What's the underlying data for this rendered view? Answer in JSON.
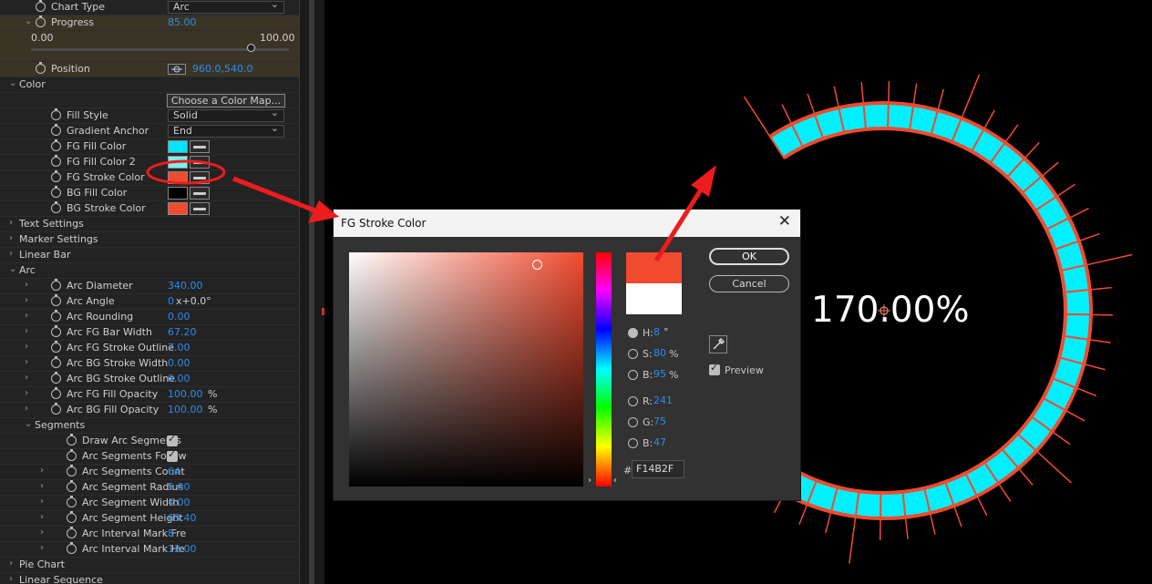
{
  "panel": {
    "rows": [
      {
        "type": "dropdown",
        "label": "Chart Type",
        "value": "Arc",
        "indent": 1,
        "arrow": "",
        "stop": true
      },
      {
        "type": "value",
        "label": "Progress",
        "value": "85.00",
        "indent": 1,
        "arrow": "⌄",
        "stop": true,
        "highlight": true
      },
      {
        "type": "slider",
        "min": "0.00",
        "max": "100.00",
        "fraction": 0.85,
        "highlight": true
      },
      {
        "type": "position",
        "label": "Position",
        "value": "960.0,540.0",
        "indent": 1,
        "arrow": "",
        "stop": true,
        "highlight": true
      },
      {
        "type": "group",
        "label": "Color",
        "indent": 0,
        "arrow": "⌄"
      },
      {
        "type": "button",
        "label": "Choose a Color Map..."
      },
      {
        "type": "dropdown",
        "label": "Fill Style",
        "value": "Solid",
        "indent": 2,
        "arrow": "",
        "stop": true
      },
      {
        "type": "dropdown",
        "label": "Gradient Anchor",
        "value": "End",
        "indent": 2,
        "arrow": "",
        "stop": true
      },
      {
        "type": "color",
        "label": "FG Fill Color",
        "color": "#00e5ff",
        "indent": 2,
        "stop": true
      },
      {
        "type": "color",
        "label": "FG Fill Color 2",
        "color": "#7af2ee",
        "indent": 2,
        "stop": true
      },
      {
        "type": "color",
        "label": "FG Stroke Color",
        "color": "#f14b2f",
        "indent": 2,
        "stop": true,
        "circled": true
      },
      {
        "type": "color",
        "label": "BG Fill Color",
        "color": "#000000",
        "indent": 2,
        "stop": true
      },
      {
        "type": "color",
        "label": "BG Stroke Color",
        "color": "#f14b2f",
        "indent": 2,
        "stop": true
      },
      {
        "type": "group",
        "label": "Text Settings",
        "indent": 0,
        "arrow": "›"
      },
      {
        "type": "group",
        "label": "Marker Settings",
        "indent": 0,
        "arrow": "›"
      },
      {
        "type": "group",
        "label": "Linear Bar",
        "indent": 0,
        "arrow": "›"
      },
      {
        "type": "group",
        "label": "Arc",
        "indent": 0,
        "arrow": "⌄"
      },
      {
        "type": "value",
        "label": "Arc Diameter",
        "value": "340.00",
        "indent": 2,
        "arrow": "›",
        "stop": true
      },
      {
        "type": "value",
        "label": "Arc Angle",
        "value": "0",
        "unit": "x+0.0°",
        "indent": 2,
        "arrow": "›",
        "stop": true
      },
      {
        "type": "value",
        "label": "Arc Rounding",
        "value": "0.00",
        "indent": 2,
        "arrow": "›",
        "stop": true
      },
      {
        "type": "value",
        "label": "Arc FG Bar Width",
        "value": "67.20",
        "indent": 2,
        "arrow": "›",
        "stop": true
      },
      {
        "type": "value",
        "label": "Arc FG Stroke Outline",
        "value": "7.00",
        "indent": 2,
        "arrow": "›",
        "stop": true
      },
      {
        "type": "value",
        "label": "Arc BG Stroke Width",
        "value": "0.00",
        "indent": 2,
        "arrow": "›",
        "stop": true
      },
      {
        "type": "value",
        "label": "Arc BG Stroke Outline",
        "value": "0.00",
        "indent": 2,
        "arrow": "›",
        "stop": true
      },
      {
        "type": "value",
        "label": "Arc FG Fill Opacity",
        "value": "100.00",
        "unit": "%",
        "indent": 2,
        "arrow": "›",
        "stop": true
      },
      {
        "type": "value",
        "label": "Arc BG Fill Opacity",
        "value": "100.00",
        "unit": "%",
        "indent": 2,
        "arrow": "›",
        "stop": true
      },
      {
        "type": "group",
        "label": "Segments",
        "indent": 1,
        "arrow": "⌄"
      },
      {
        "type": "check",
        "label": "Draw Arc Segments",
        "indent": 3,
        "stop": true
      },
      {
        "type": "check",
        "label": "Arc Segments Follow",
        "indent": 3,
        "stop": true
      },
      {
        "type": "value",
        "label": "Arc Segments Count",
        "value": "64",
        "indent": 3,
        "arrow": "›",
        "stop": true
      },
      {
        "type": "value",
        "label": "Arc Segment Radius",
        "value": "5.00",
        "indent": 3,
        "arrow": "›",
        "stop": true
      },
      {
        "type": "value",
        "label": "Arc Segment Width",
        "value": "4.00",
        "indent": 3,
        "arrow": "›",
        "stop": true
      },
      {
        "type": "value",
        "label": "Arc Segment Height",
        "value": "63.40",
        "indent": 3,
        "arrow": "›",
        "stop": true
      },
      {
        "type": "value",
        "label": "Arc Interval Mark Fre",
        "value": "8",
        "indent": 3,
        "arrow": "›",
        "stop": true
      },
      {
        "type": "value",
        "label": "Arc Interval Mark He",
        "value": "12.00",
        "indent": 3,
        "arrow": "›",
        "stop": true
      },
      {
        "type": "group",
        "label": "Pie Chart",
        "indent": 0,
        "arrow": "›"
      },
      {
        "type": "group",
        "label": "Linear Sequence",
        "indent": 0,
        "arrow": "›"
      }
    ]
  },
  "viewer": {
    "readout": "170.00%",
    "fill_color": "#00f0ff",
    "stroke_color": "#f14b2f",
    "bg_color": "#000000"
  },
  "dialog": {
    "title": "FG Stroke Color",
    "close_glyph": "✕",
    "ok_label": "OK",
    "cancel_label": "Cancel",
    "h_label": "H:",
    "h_value": "8",
    "h_unit": "°",
    "s_label": "S:",
    "s_value": "80",
    "s_unit": "%",
    "b_label": "B:",
    "b_value": "95",
    "b_unit": "%",
    "r_label": "R:",
    "r_value": "241",
    "g_label": "G:",
    "g_value": "75",
    "bb_label": "B:",
    "bb_value": "47",
    "hash": "#",
    "hex_value": "F14B2F",
    "preview_label": "Preview",
    "new_color": "#f14b2f",
    "old_color": "#ffffff",
    "picker_fraction": {
      "saturation": 0.8,
      "brightness": 0.95
    },
    "hue_fraction": 0.022
  },
  "annotation_color": "#ee1c1c"
}
